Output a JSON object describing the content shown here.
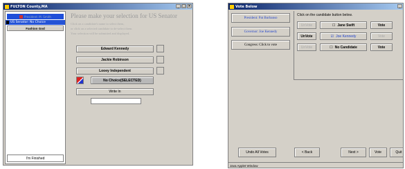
{
  "left_window": {
    "title": "FULTON County,MA",
    "sidebar": {
      "president_item": "President: M. Smith",
      "senator_item": "US Senator: No Choice",
      "fashion_item": "Fashion God",
      "finish_button": "I'm Finished"
    },
    "heading": "Please make your selection for US Senator",
    "instructions": [
      "Click on a candidate's name to select them,",
      "or click on a selected candidate to de-select them.",
      "Your selection will be submitted and displayed."
    ],
    "candidates": [
      "Edward Kennedy",
      "Jackie Robinson",
      "Looey Independent"
    ],
    "no_choice": "No Choice(SELECTED)",
    "write_in": "Write In",
    "write_in_value": ""
  },
  "right_window": {
    "title": "Vote Below",
    "races": [
      "President: Pat Burbanso",
      "Governor: Joe Kennedy",
      "Congress: Click to vote"
    ],
    "instruction": "Click on the candidate button below.",
    "rows": [
      {
        "unvote": "UnVote",
        "candidate": "Jane Swift",
        "mark": "☐",
        "vote": "Vote"
      },
      {
        "unvote": "UnVote",
        "candidate": "Joe Kennedy",
        "mark": "☑",
        "vote": "Vote"
      },
      {
        "unvote": "UnVote",
        "candidate": "No Candidate",
        "mark": "☐",
        "vote": "Vote"
      }
    ],
    "bottom": {
      "undo": "Undo All Votes",
      "back": "< Back",
      "next": "Next >",
      "vote": "Vote",
      "quit": "Quit"
    },
    "status": "Java Applet Window"
  }
}
